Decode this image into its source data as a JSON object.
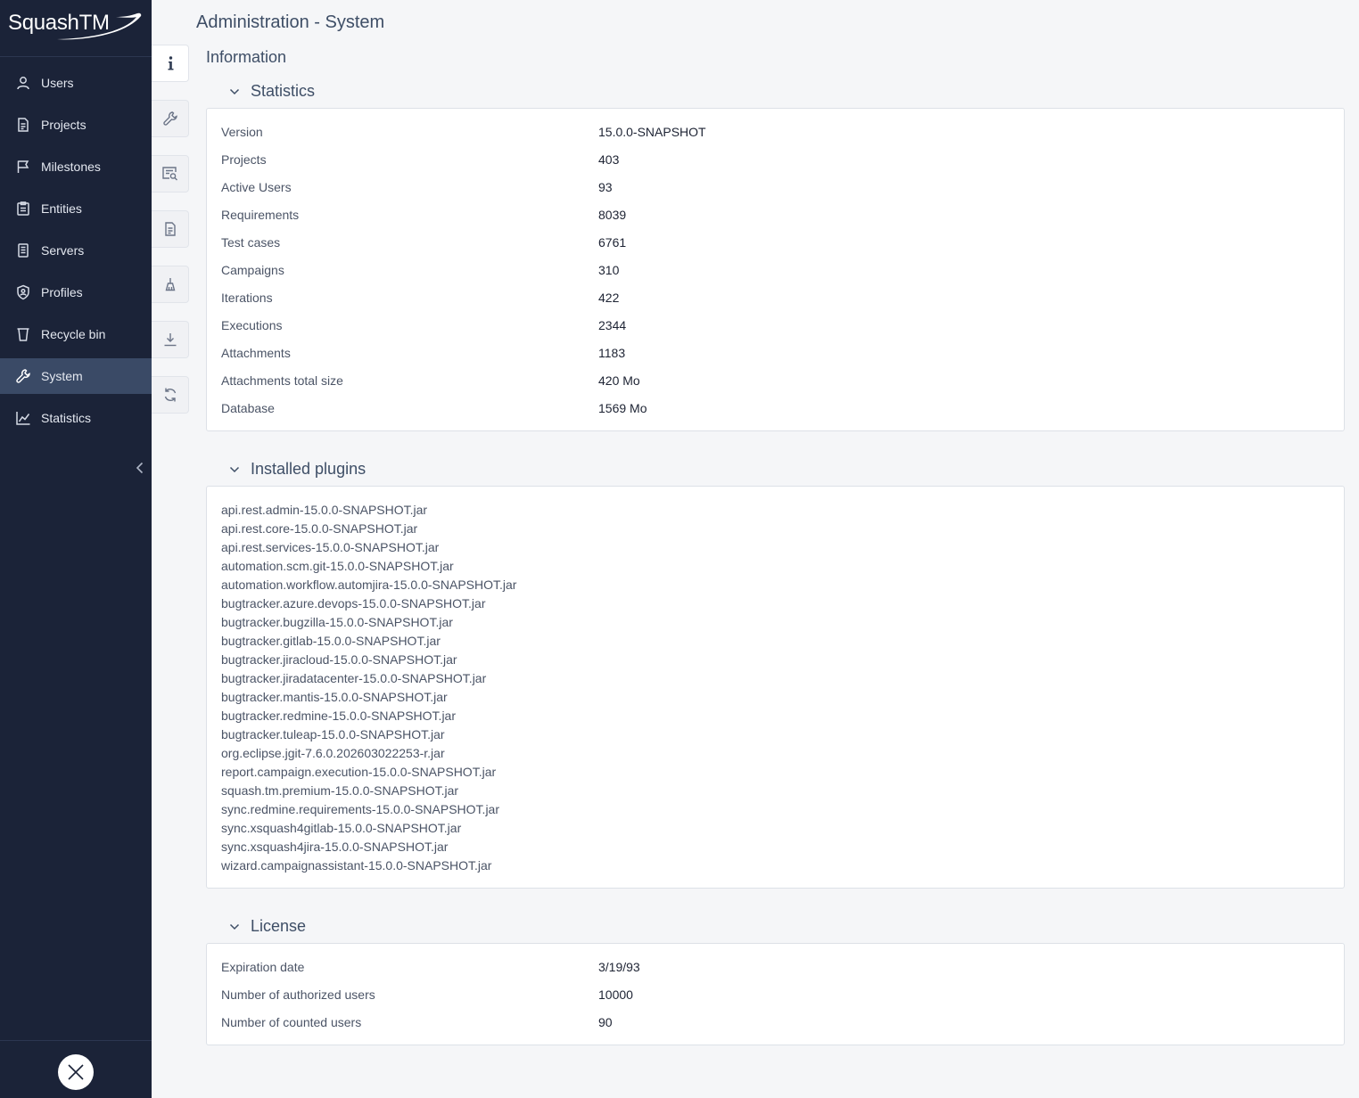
{
  "app": {
    "logo_text": "SquashTM"
  },
  "sidebar": {
    "items": [
      {
        "label": "Users",
        "icon": "user-icon"
      },
      {
        "label": "Projects",
        "icon": "document-icon"
      },
      {
        "label": "Milestones",
        "icon": "flag-icon"
      },
      {
        "label": "Entities",
        "icon": "clipboard-icon"
      },
      {
        "label": "Servers",
        "icon": "server-icon"
      },
      {
        "label": "Profiles",
        "icon": "shield-icon"
      },
      {
        "label": "Recycle bin",
        "icon": "trash-icon"
      },
      {
        "label": "System",
        "icon": "wrench-icon",
        "active": true
      },
      {
        "label": "Statistics",
        "icon": "chart-icon"
      }
    ]
  },
  "header": {
    "title": "Administration - System"
  },
  "tabs": [
    {
      "icon": "info-icon",
      "active": true
    },
    {
      "icon": "wrench-icon"
    },
    {
      "icon": "message-search-icon"
    },
    {
      "icon": "document-icon"
    },
    {
      "icon": "broom-icon"
    },
    {
      "icon": "download-icon"
    },
    {
      "icon": "sync-icon"
    }
  ],
  "main": {
    "heading": "Information",
    "statistics": {
      "title": "Statistics",
      "rows": [
        {
          "key": "Version",
          "value": "15.0.0-SNAPSHOT"
        },
        {
          "key": "Projects",
          "value": "403"
        },
        {
          "key": "Active Users",
          "value": "93"
        },
        {
          "key": "Requirements",
          "value": "8039"
        },
        {
          "key": "Test cases",
          "value": "6761"
        },
        {
          "key": "Campaigns",
          "value": "310"
        },
        {
          "key": "Iterations",
          "value": "422"
        },
        {
          "key": "Executions",
          "value": "2344"
        },
        {
          "key": "Attachments",
          "value": "1183"
        },
        {
          "key": "Attachments total size",
          "value": "420 Mo"
        },
        {
          "key": "Database",
          "value": "1569 Mo"
        }
      ]
    },
    "plugins": {
      "title": "Installed plugins",
      "items": [
        "api.rest.admin-15.0.0-SNAPSHOT.jar",
        "api.rest.core-15.0.0-SNAPSHOT.jar",
        "api.rest.services-15.0.0-SNAPSHOT.jar",
        "automation.scm.git-15.0.0-SNAPSHOT.jar",
        "automation.workflow.automjira-15.0.0-SNAPSHOT.jar",
        "bugtracker.azure.devops-15.0.0-SNAPSHOT.jar",
        "bugtracker.bugzilla-15.0.0-SNAPSHOT.jar",
        "bugtracker.gitlab-15.0.0-SNAPSHOT.jar",
        "bugtracker.jiracloud-15.0.0-SNAPSHOT.jar",
        "bugtracker.jiradatacenter-15.0.0-SNAPSHOT.jar",
        "bugtracker.mantis-15.0.0-SNAPSHOT.jar",
        "bugtracker.redmine-15.0.0-SNAPSHOT.jar",
        "bugtracker.tuleap-15.0.0-SNAPSHOT.jar",
        "org.eclipse.jgit-7.6.0.202603022253-r.jar",
        "report.campaign.execution-15.0.0-SNAPSHOT.jar",
        "squash.tm.premium-15.0.0-SNAPSHOT.jar",
        "sync.redmine.requirements-15.0.0-SNAPSHOT.jar",
        "sync.xsquash4gitlab-15.0.0-SNAPSHOT.jar",
        "sync.xsquash4jira-15.0.0-SNAPSHOT.jar",
        "wizard.campaignassistant-15.0.0-SNAPSHOT.jar"
      ]
    },
    "license": {
      "title": "License",
      "rows": [
        {
          "key": "Expiration date",
          "value": "3/19/93"
        },
        {
          "key": "Number of authorized users",
          "value": "10000"
        },
        {
          "key": "Number of counted users",
          "value": "90"
        }
      ]
    }
  },
  "colors": {
    "sidebar_bg": "#1b2338",
    "sidebar_active": "#3a4a66",
    "heading": "#3e4e66",
    "content_bg": "#f5f6f8"
  }
}
